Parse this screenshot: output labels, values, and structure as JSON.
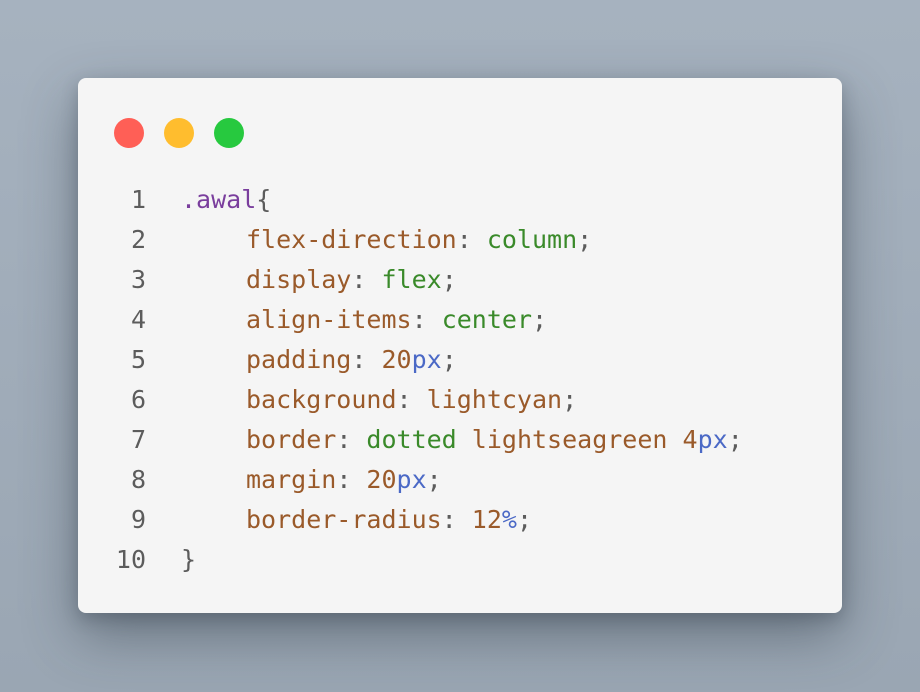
{
  "window": {
    "controls": [
      {
        "name": "close",
        "color": "#ff5f56"
      },
      {
        "name": "minimize",
        "color": "#ffbd2e"
      },
      {
        "name": "maximize",
        "color": "#27c93f"
      }
    ]
  },
  "colors": {
    "selector": "#7a3e9d",
    "property": "#9a5a2a",
    "value_keyword": "#3a8a2a",
    "unit": "#4b69c6",
    "punctuation": "#5c5c5c"
  },
  "code": {
    "lines": [
      {
        "n": "1",
        "indent": false,
        "tokens": [
          {
            "t": ".awal",
            "c": "selector"
          },
          {
            "t": "{",
            "c": "punct"
          }
        ]
      },
      {
        "n": "2",
        "indent": true,
        "tokens": [
          {
            "t": "flex-direction",
            "c": "prop"
          },
          {
            "t": ": ",
            "c": "punct"
          },
          {
            "t": "column",
            "c": "value"
          },
          {
            "t": ";",
            "c": "punct"
          }
        ]
      },
      {
        "n": "3",
        "indent": true,
        "tokens": [
          {
            "t": "display",
            "c": "prop"
          },
          {
            "t": ": ",
            "c": "punct"
          },
          {
            "t": "flex",
            "c": "value"
          },
          {
            "t": ";",
            "c": "punct"
          }
        ]
      },
      {
        "n": "4",
        "indent": true,
        "tokens": [
          {
            "t": "align-items",
            "c": "prop"
          },
          {
            "t": ": ",
            "c": "punct"
          },
          {
            "t": "center",
            "c": "value"
          },
          {
            "t": ";",
            "c": "punct"
          }
        ]
      },
      {
        "n": "5",
        "indent": true,
        "tokens": [
          {
            "t": "padding",
            "c": "prop"
          },
          {
            "t": ": ",
            "c": "punct"
          },
          {
            "t": "20",
            "c": "number"
          },
          {
            "t": "px",
            "c": "unit"
          },
          {
            "t": ";",
            "c": "punct"
          }
        ]
      },
      {
        "n": "6",
        "indent": true,
        "tokens": [
          {
            "t": "background",
            "c": "prop"
          },
          {
            "t": ": ",
            "c": "punct"
          },
          {
            "t": "lightcyan",
            "c": "plain"
          },
          {
            "t": ";",
            "c": "punct"
          }
        ]
      },
      {
        "n": "7",
        "indent": true,
        "tokens": [
          {
            "t": "border",
            "c": "prop"
          },
          {
            "t": ": ",
            "c": "punct"
          },
          {
            "t": "dotted",
            "c": "value"
          },
          {
            "t": " ",
            "c": "punct"
          },
          {
            "t": "lightseagreen",
            "c": "plain"
          },
          {
            "t": " ",
            "c": "punct"
          },
          {
            "t": "4",
            "c": "number"
          },
          {
            "t": "px",
            "c": "unit"
          },
          {
            "t": ";",
            "c": "punct"
          }
        ]
      },
      {
        "n": "8",
        "indent": true,
        "tokens": [
          {
            "t": "margin",
            "c": "prop"
          },
          {
            "t": ": ",
            "c": "punct"
          },
          {
            "t": "20",
            "c": "number"
          },
          {
            "t": "px",
            "c": "unit"
          },
          {
            "t": ";",
            "c": "punct"
          }
        ]
      },
      {
        "n": "9",
        "indent": true,
        "tokens": [
          {
            "t": "border-radius",
            "c": "prop"
          },
          {
            "t": ": ",
            "c": "punct"
          },
          {
            "t": "12",
            "c": "number"
          },
          {
            "t": "%",
            "c": "unit"
          },
          {
            "t": ";",
            "c": "punct"
          }
        ]
      },
      {
        "n": "10",
        "indent": false,
        "tokens": [
          {
            "t": "}",
            "c": "punct"
          }
        ]
      }
    ]
  }
}
